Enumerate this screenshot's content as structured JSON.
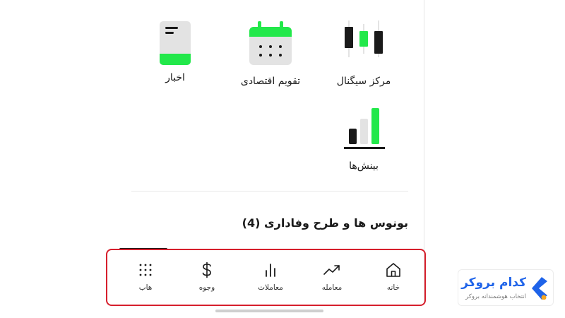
{
  "hub": {
    "tiles": [
      {
        "id": "signals",
        "label": "مرکز سیگنال",
        "icon": "candlestick-chart-icon"
      },
      {
        "id": "calendar",
        "label": "تقویم اقتصادی",
        "icon": "calendar-icon"
      },
      {
        "id": "news",
        "label": "اخبار",
        "icon": "news-book-icon"
      },
      {
        "id": "insights",
        "label": "بینش‌ها",
        "icon": "bar-growth-icon"
      }
    ]
  },
  "bonus_section": {
    "title": "بونوس ها و طرح وفاداری (4)"
  },
  "bottom_nav": {
    "items": [
      {
        "id": "home",
        "label": "خانه",
        "icon": "home-icon"
      },
      {
        "id": "trade",
        "label": "معامله",
        "icon": "trend-up-icon"
      },
      {
        "id": "trades",
        "label": "معاملات",
        "icon": "bar-chart-icon"
      },
      {
        "id": "funds",
        "label": "وجوه",
        "icon": "dollar-icon"
      },
      {
        "id": "hub",
        "label": "هاب",
        "icon": "grid-dots-icon"
      }
    ],
    "active": "hub"
  },
  "watermark": {
    "title": "کدام بروکر",
    "subtitle": "انتخاب هوشمندانه بروکر"
  },
  "colors": {
    "accent_green": "#22e84a",
    "dark": "#1a1a1a",
    "highlight_red": "#d61f2c",
    "brand_blue": "#1e63e9",
    "brand_orange": "#f5a623"
  }
}
